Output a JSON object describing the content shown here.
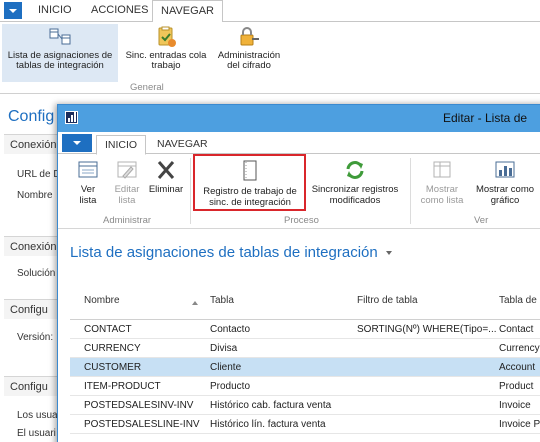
{
  "background": {
    "tabs": [
      "INICIO",
      "ACCIONES",
      "NAVEGAR"
    ],
    "active_tab": "NAVEGAR",
    "ribbon": {
      "buttons": [
        {
          "label1": "Lista de asignaciones de",
          "label2": "tablas de integración",
          "icon": "table-mapping-icon"
        },
        {
          "label1": "Sinc. entradas cola",
          "label2": "trabajo",
          "icon": "sync-queue-icon"
        },
        {
          "label1": "Administración",
          "label2": "del cifrado",
          "icon": "encryption-key-icon"
        }
      ],
      "group": "General"
    },
    "page_title": "Config",
    "sections": [
      "Conexión",
      "Conexión",
      "Configu",
      "Configu"
    ],
    "fields": [
      "URL de D",
      "Nombre",
      "Solución",
      "Versión:",
      "Los usua",
      "El usuari"
    ]
  },
  "window": {
    "title": "Editar - Lista de",
    "tabs": [
      "INICIO",
      "NAVEGAR"
    ],
    "active_tab": "INICIO",
    "ribbon": {
      "buttons": [
        {
          "label1": "Ver",
          "label2": "lista",
          "icon": "view-list-icon",
          "enabled": true
        },
        {
          "label1": "Editar",
          "label2": "lista",
          "icon": "edit-list-icon",
          "enabled": false
        },
        {
          "label1": "Eliminar",
          "label2": "",
          "icon": "delete-icon",
          "enabled": true
        },
        {
          "label1": "Registro de trabajo de",
          "label2": "sinc. de integración",
          "icon": "document-log-icon",
          "enabled": true
        },
        {
          "label1": "Sincronizar registros",
          "label2": "modificados",
          "icon": "sync-icon",
          "enabled": true
        },
        {
          "label1": "Mostrar",
          "label2": "como lista",
          "icon": "show-list-icon",
          "enabled": false
        },
        {
          "label1": "Mostrar como",
          "label2": "gráfico",
          "icon": "chart-icon",
          "enabled": true
        }
      ],
      "groups": [
        "Administrar",
        "Proceso",
        "Ver"
      ]
    },
    "list_title": "Lista de asignaciones de tablas de integración",
    "columns": [
      "Nombre",
      "Tabla",
      "Filtro de tabla",
      "Tabla de"
    ],
    "rows": [
      {
        "name": "CONTACT",
        "table": "Contacto",
        "filter": "SORTING(Nº) WHERE(Tipo=...",
        "target": "Contact"
      },
      {
        "name": "CURRENCY",
        "table": "Divisa",
        "filter": "",
        "target": "Currency"
      },
      {
        "name": "CUSTOMER",
        "table": "Cliente",
        "filter": "",
        "target": "Account"
      },
      {
        "name": "ITEM-PRODUCT",
        "table": "Producto",
        "filter": "",
        "target": "Product"
      },
      {
        "name": "POSTEDSALESINV-INV",
        "table": "Histórico cab. factura venta",
        "filter": "",
        "target": "Invoice"
      },
      {
        "name": "POSTEDSALESLINE-INV",
        "table": "Histórico lín. factura venta",
        "filter": "",
        "target": "Invoice P"
      }
    ],
    "selected_row": "CUSTOMER"
  },
  "colors": {
    "accent": "#1e6fc1",
    "titlebar": "#4d9fe0",
    "highlight_box": "#d9262b",
    "selected_row": "#c7e0f4"
  }
}
